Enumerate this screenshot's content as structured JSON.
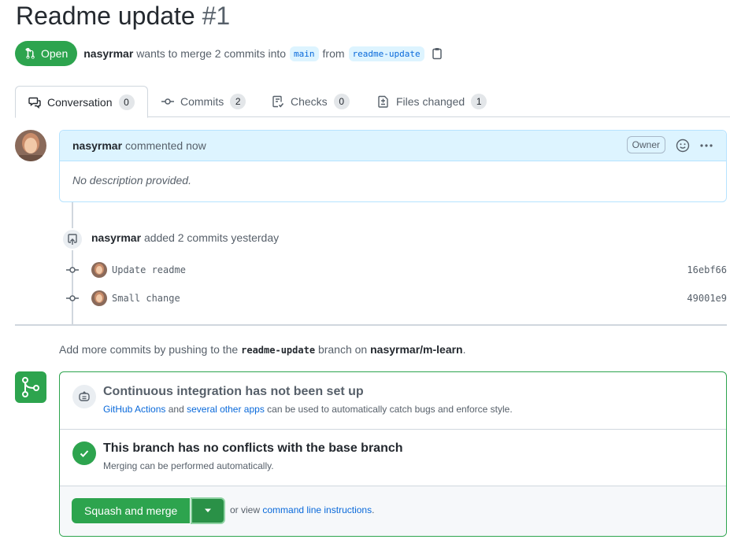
{
  "pr": {
    "title": "Readme update",
    "number": "#1",
    "state": "Open",
    "author": "nasyrmar",
    "merge_text": "wants to merge 2 commits into",
    "base_branch": "main",
    "from_text": "from",
    "head_branch": "readme-update"
  },
  "tabs": [
    {
      "label": "Conversation",
      "count": "0",
      "icon": "comment-discussion-icon"
    },
    {
      "label": "Commits",
      "count": "2",
      "icon": "git-commit-icon"
    },
    {
      "label": "Checks",
      "count": "0",
      "icon": "checklist-icon"
    },
    {
      "label": "Files changed",
      "count": "1",
      "icon": "file-diff-icon"
    }
  ],
  "comment": {
    "author": "nasyrmar",
    "action": "commented now",
    "role": "Owner",
    "body": "No description provided."
  },
  "event": {
    "author": "nasyrmar",
    "action": "added 2 commits yesterday"
  },
  "commits": [
    {
      "message": "Update readme",
      "sha": "16ebf66"
    },
    {
      "message": "Small change",
      "sha": "49001e9"
    }
  ],
  "push_hint": {
    "prefix": "Add more commits by pushing to the",
    "branch": "readme-update",
    "middle": "branch on",
    "repo": "nasyrmar/m-learn",
    "suffix": "."
  },
  "merge_box": {
    "ci_title": "Continuous integration has not been set up",
    "ci_link1": "GitHub Actions",
    "ci_and": "and",
    "ci_link2": "several other apps",
    "ci_rest": "can be used to automatically catch bugs and enforce style.",
    "conflict_title": "This branch has no conflicts with the base branch",
    "conflict_sub": "Merging can be performed automatically.",
    "merge_button": "Squash and merge",
    "or_view": "or view",
    "cli_link": "command line instructions",
    "cli_suffix": "."
  },
  "colors": {
    "accent_green": "#2da44e",
    "link_blue": "#0969da",
    "comment_header_bg": "#ddf4ff"
  }
}
